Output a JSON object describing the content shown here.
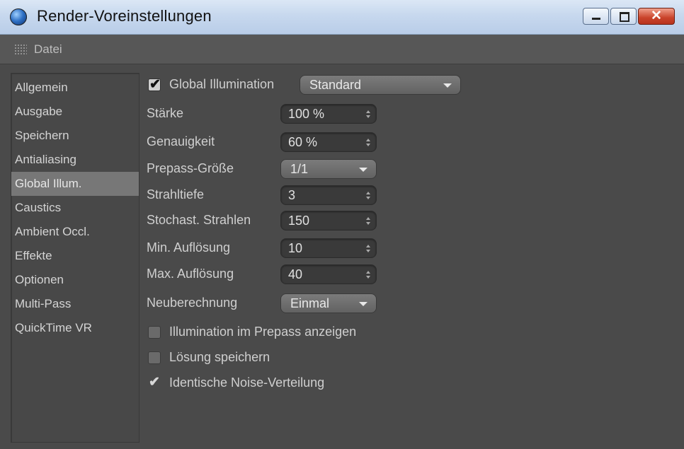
{
  "window": {
    "title": "Render-Voreinstellungen",
    "close_glyph": "✕"
  },
  "menu": {
    "items": [
      "Datei"
    ]
  },
  "sidebar": {
    "items": [
      {
        "label": "Allgemein"
      },
      {
        "label": "Ausgabe"
      },
      {
        "label": "Speichern"
      },
      {
        "label": "Antialiasing"
      },
      {
        "label": "Global Illum."
      },
      {
        "label": "Caustics"
      },
      {
        "label": "Ambient Occl."
      },
      {
        "label": "Effekte"
      },
      {
        "label": "Optionen"
      },
      {
        "label": "Multi-Pass"
      },
      {
        "label": "QuickTime VR"
      }
    ],
    "selected": "Global Illum."
  },
  "gi": {
    "enabled_label": "Global Illumination",
    "enabled": true,
    "mode": "Standard",
    "fields": {
      "staerke": {
        "label": "Stärke",
        "value": "100 %"
      },
      "genauigkeit": {
        "label": "Genauigkeit",
        "value": "60 %"
      },
      "prepass": {
        "label": "Prepass-Größe",
        "value": "1/1"
      },
      "strahltiefe": {
        "label": "Strahltiefe",
        "value": "3"
      },
      "stochast": {
        "label": "Stochast. Strahlen",
        "value": "150"
      },
      "min": {
        "label": "Min. Auflösung",
        "value": "10"
      },
      "max": {
        "label": "Max. Auflösung",
        "value": "40"
      },
      "neuberechnung": {
        "label": "Neuberechnung",
        "value": "Einmal"
      }
    },
    "options": {
      "show_prepass": {
        "label": "Illumination im Prepass anzeigen",
        "checked": false
      },
      "save_solution": {
        "label": "Lösung speichern",
        "checked": false
      },
      "identical_noise": {
        "label": "Identische Noise-Verteilung",
        "checked": true
      }
    },
    "check_glyph": "✔"
  },
  "colors": {
    "panel_bg": "#4a4a4a",
    "selected_bg": "#777777",
    "titlebar": "#c7d8ee",
    "close_red": "#c9432a"
  }
}
